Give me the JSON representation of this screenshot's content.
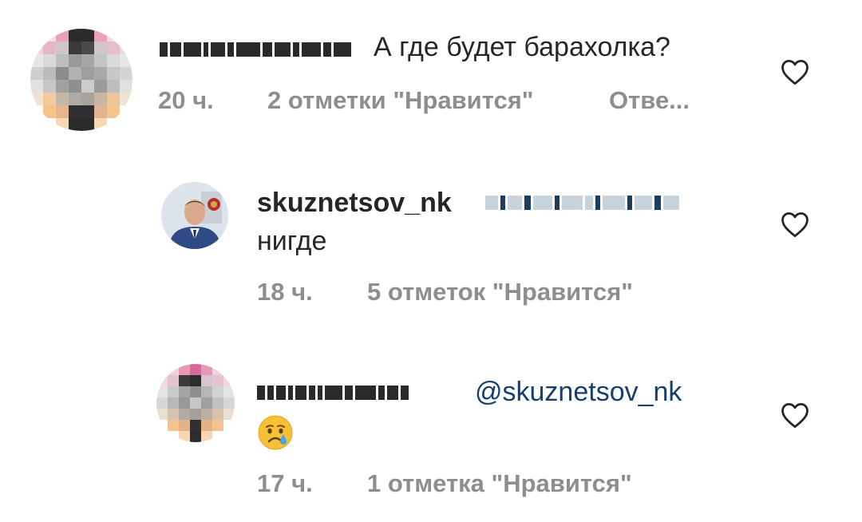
{
  "comments": [
    {
      "username_hidden": true,
      "text": "А где будет барахолка?",
      "time": "20 ч.",
      "likes": "2 отметки \"Нравится\"",
      "reply": "Отве...",
      "like_icon": "heart-outline-icon"
    },
    {
      "username": "skuznetsov_nk",
      "mention_hidden": true,
      "text": "нигде",
      "time": "18 ч.",
      "likes": "5 отметок \"Нравится\"",
      "like_icon": "heart-outline-icon"
    },
    {
      "username_hidden": true,
      "mention": "@skuznetsov_nk",
      "emoji": "crying-face-emoji",
      "time": "17 ч.",
      "likes": "1 отметка \"Нравится\"",
      "like_icon": "heart-outline-icon"
    }
  ],
  "colors": {
    "text": "#262626",
    "meta": "#8e8e8e",
    "mention": "#183f6b",
    "heart": "#262626"
  }
}
